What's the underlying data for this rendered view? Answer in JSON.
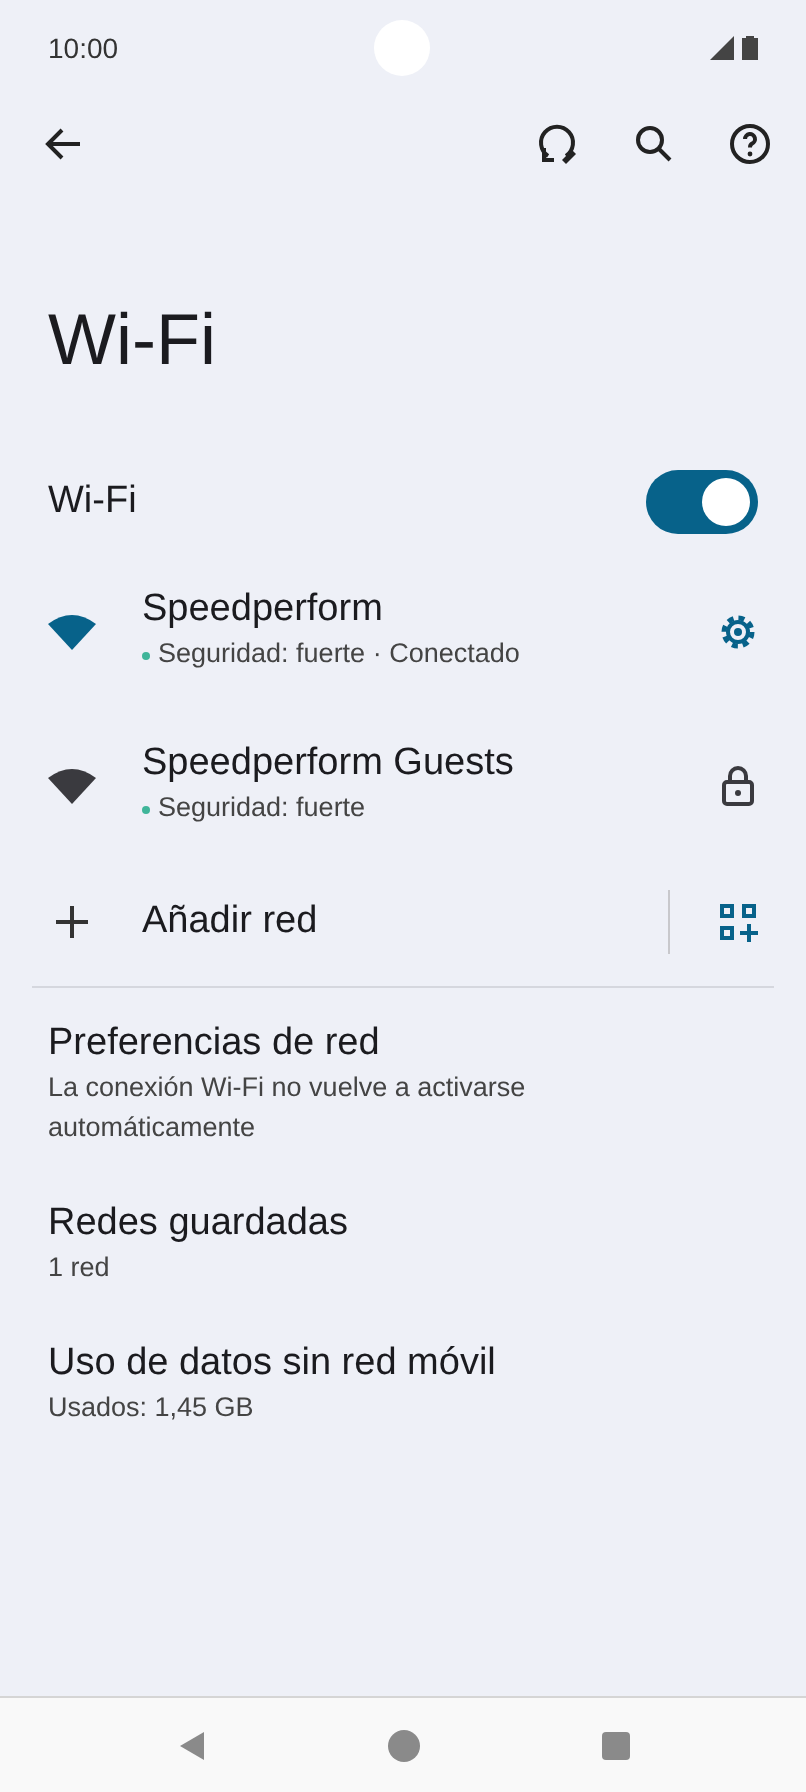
{
  "status_bar": {
    "time": "10:00"
  },
  "title": "Wi-Fi",
  "wifi_toggle": {
    "label": "Wi-Fi",
    "on": true
  },
  "networks": [
    {
      "name": "Speedperform",
      "security": "Seguridad: fuerte · Conectado",
      "connected": true
    },
    {
      "name": "Speedperform Guests",
      "security": "Seguridad: fuerte",
      "connected": false
    }
  ],
  "add_network": {
    "label": "Añadir red"
  },
  "settings": [
    {
      "title": "Preferencias de red",
      "subtitle": "La conexión Wi-Fi no vuelve a activarse automáticamente"
    },
    {
      "title": "Redes guardadas",
      "subtitle": "1 red"
    },
    {
      "title": "Uso de datos sin red móvil",
      "subtitle": "Usados: 1,45 GB"
    }
  ]
}
